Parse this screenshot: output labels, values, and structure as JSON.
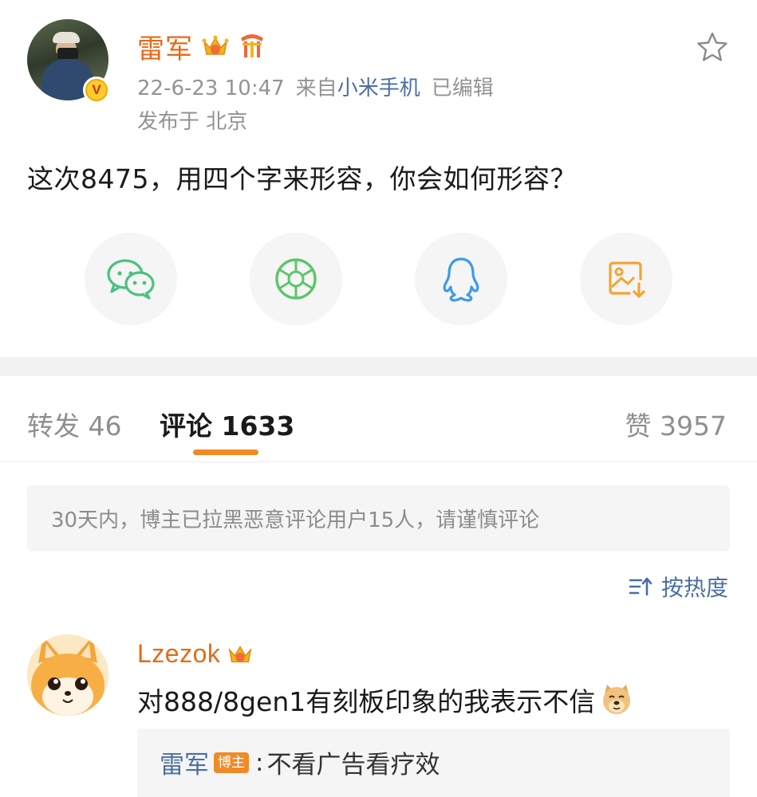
{
  "post": {
    "author": "雷军",
    "time": "22-6-23 10:47",
    "source_prefix": "来自",
    "source": "小米手机",
    "edited": "已编辑",
    "location": "发布于 北京",
    "text": "这次8475，用四个字来形容，你会如何形容？"
  },
  "share": {
    "items": [
      {
        "icon": "wechat-icon",
        "color": "#4cc180"
      },
      {
        "icon": "moments-icon",
        "color": "#5ec46a"
      },
      {
        "icon": "qq-icon",
        "color": "#3d9be9"
      },
      {
        "icon": "save-image-icon",
        "color": "#f2a531"
      }
    ]
  },
  "tabs": {
    "repost": "转发 46",
    "comments": "评论 1633",
    "likes": "赞 3957"
  },
  "notice": "30天内，博主已拉黑恶意评论用户15人，请谨慎评论",
  "sort": {
    "label": "按热度"
  },
  "comment": {
    "author": "Lzezok",
    "text": "对888/8gen1有刻板印象的我表示不信",
    "reply": {
      "author": "雷军",
      "badge": "博主",
      "separator": ":",
      "text": "不看广告看疗效"
    }
  },
  "colors": {
    "username": "#e56a17",
    "link": "#4a6fa5",
    "accent": "#f08a24"
  }
}
